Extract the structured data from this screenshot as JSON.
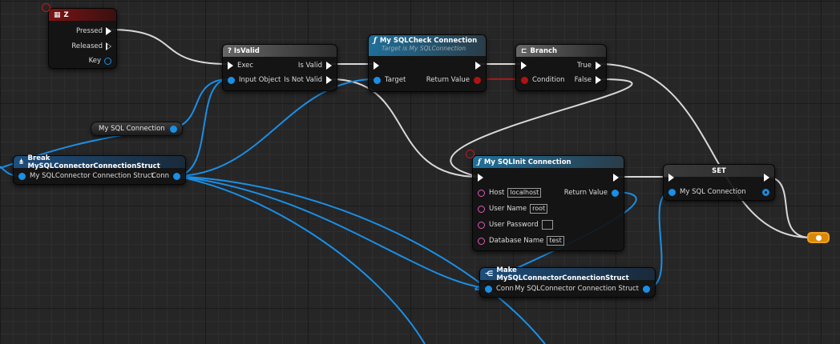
{
  "event_node": {
    "title": "Z",
    "pins": {
      "pressed": "Pressed",
      "released": "Released",
      "key": "Key"
    }
  },
  "isvalid_node": {
    "title": "? IsValid",
    "pins": {
      "exec": "Exec",
      "input_object": "Input Object",
      "is_valid": "Is Valid",
      "is_not_valid": "Is Not Valid"
    }
  },
  "check_node": {
    "title": "My SQLCheck Connection",
    "subtitle": "Target is My SQLConnection",
    "pins": {
      "target": "Target",
      "return_value": "Return Value"
    }
  },
  "branch_node": {
    "title": "Branch",
    "pins": {
      "condition": "Condition",
      "true": "True",
      "false": "False"
    }
  },
  "mysql_var": {
    "label": "My SQL Connection"
  },
  "break_node": {
    "title": "Break MySQLConnectorConnectionStruct",
    "pins": {
      "struct": "My SQLConnector Connection Struct",
      "conn": "Conn"
    }
  },
  "init_node": {
    "title": "My SQLInit Connection",
    "pins": {
      "host": "Host",
      "user_name": "User Name",
      "user_password": "User Password",
      "database_name": "Database Name",
      "return_value": "Return Value"
    },
    "values": {
      "host": "localhost",
      "user_name": "root",
      "user_password": "",
      "database_name": "test"
    }
  },
  "set_node": {
    "title": "SET",
    "pins": {
      "mysql_connection": "My SQL Connection"
    }
  },
  "make_node": {
    "title": "Make MySQLConnectorConnectionStruct",
    "pins": {
      "conn": "Conn",
      "struct": "My SQLConnector Connection Struct"
    }
  },
  "colors": {
    "exec_wire": "#d8d8d8",
    "object_wire": "#1a8fe6",
    "bool_wire": "#b01313",
    "reroute": "#d9890a"
  }
}
